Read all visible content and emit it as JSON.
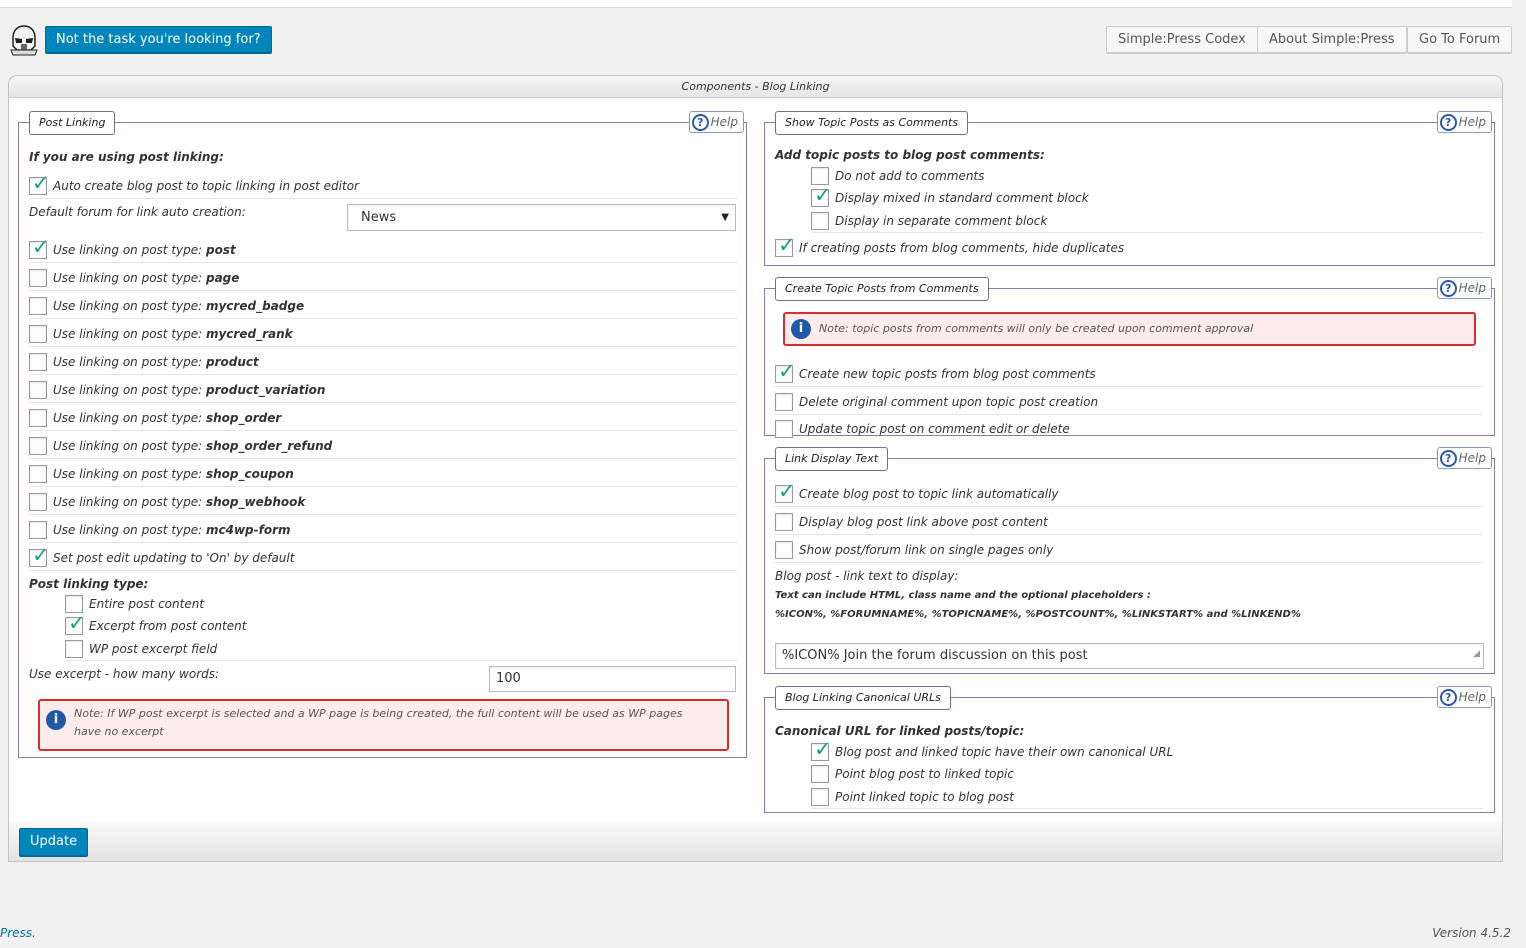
{
  "header": {
    "task_button": "Not the task you're looking for?",
    "links": [
      "Simple:Press Codex",
      "About Simple:Press",
      "Go To Forum"
    ]
  },
  "panel_title": "Components - Blog Linking",
  "help_label": "Help",
  "post_linking": {
    "legend": "Post Linking",
    "intro": "If you are using post linking:",
    "auto_create": {
      "label": "Auto create blog post to topic linking in post editor",
      "checked": true
    },
    "default_forum_label": "Default forum for link auto creation:",
    "default_forum_value": "News",
    "prefix": "Use linking on post type: ",
    "post_types": [
      {
        "name": "post",
        "checked": true
      },
      {
        "name": "page",
        "checked": false
      },
      {
        "name": "mycred_badge",
        "checked": false
      },
      {
        "name": "mycred_rank",
        "checked": false
      },
      {
        "name": "product",
        "checked": false
      },
      {
        "name": "product_variation",
        "checked": false
      },
      {
        "name": "shop_order",
        "checked": false
      },
      {
        "name": "shop_order_refund",
        "checked": false
      },
      {
        "name": "shop_coupon",
        "checked": false
      },
      {
        "name": "shop_webhook",
        "checked": false
      },
      {
        "name": "mc4wp-form",
        "checked": false
      }
    ],
    "edit_updating": {
      "label": "Set post edit updating to 'On' by default",
      "checked": true
    },
    "linking_type_label": "Post linking type:",
    "linking_types": [
      {
        "label": "Entire post content",
        "checked": false
      },
      {
        "label": "Excerpt from post content",
        "checked": true
      },
      {
        "label": "WP post excerpt field",
        "checked": false
      }
    ],
    "excerpt_words_label": "Use excerpt - how many words:",
    "excerpt_words_value": "100",
    "note": "Note: If WP post excerpt is selected and a WP page is being created, the full content will be used as WP pages have no excerpt"
  },
  "show_topic_posts": {
    "legend": "Show Topic Posts as Comments",
    "intro": "Add topic posts to blog post comments:",
    "options": [
      {
        "label": "Do not add to comments",
        "checked": false
      },
      {
        "label": "Display mixed in standard comment block",
        "checked": true
      },
      {
        "label": "Display in separate comment block",
        "checked": false
      }
    ],
    "hide_duplicates": {
      "label": "If creating posts from blog comments, hide duplicates",
      "checked": true
    }
  },
  "create_topic_posts": {
    "legend": "Create Topic Posts from Comments",
    "note": "Note: topic posts from comments will only be created upon comment approval",
    "options": [
      {
        "label": "Create new topic posts from blog post comments",
        "checked": true
      },
      {
        "label": "Delete original comment upon topic post creation",
        "checked": false
      },
      {
        "label": "Update topic post on comment edit or delete",
        "checked": false
      }
    ]
  },
  "link_display": {
    "legend": "Link Display Text",
    "options": [
      {
        "label": "Create blog post to topic link automatically",
        "checked": true
      },
      {
        "label": "Display blog post link above post content",
        "checked": false
      },
      {
        "label": "Show post/forum link on single pages only",
        "checked": false
      }
    ],
    "text_label": "Blog post - link text to display:",
    "hint1": "Text can include HTML, class name and the optional placeholders :",
    "hint2": "%ICON%, %FORUMNAME%, %TOPICNAME%, %POSTCOUNT%, %LINKSTART% and %LINKEND%",
    "text_value": "%ICON% Join the forum discussion on this post"
  },
  "canonical": {
    "legend": "Blog Linking Canonical URLs",
    "intro": "Canonical URL for linked posts/topic:",
    "options": [
      {
        "label": "Blog post and linked topic have their own canonical URL",
        "checked": true
      },
      {
        "label": "Point blog post to linked topic",
        "checked": false
      },
      {
        "label": "Point linked topic to blog post",
        "checked": false
      }
    ]
  },
  "update_button": "Update",
  "footer": {
    "left": "Press.",
    "version": "Version 4.5.2"
  }
}
